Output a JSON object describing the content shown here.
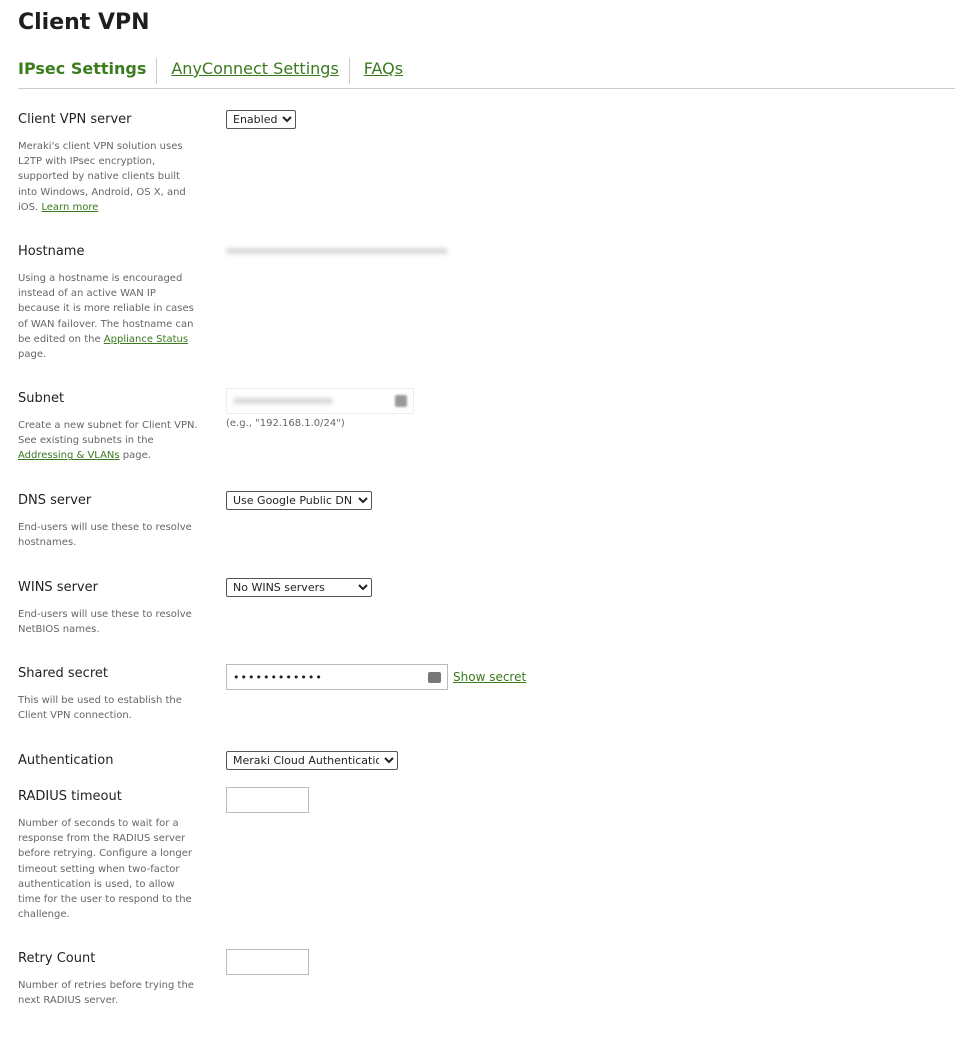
{
  "page": {
    "title": "Client VPN"
  },
  "tabs": [
    {
      "label": "IPsec Settings",
      "active": true
    },
    {
      "label": "AnyConnect Settings"
    },
    {
      "label": "FAQs"
    }
  ],
  "fields": {
    "server": {
      "label": "Client VPN server",
      "desc": "Meraki's client VPN solution uses L2TP with IPsec encryption, supported by native clients built into Windows, Android, OS X, and iOS. ",
      "link": "Learn more",
      "value": "Enabled"
    },
    "hostname": {
      "label": "Hostname",
      "desc1": "Using a hostname is encouraged instead of an active WAN IP because it is more reliable in cases of WAN failover. The hostname can be edited on the ",
      "link": "Appliance Status",
      "desc2": " page."
    },
    "subnet": {
      "label": "Subnet",
      "desc1": "Create a new subnet for Client VPN. See existing subnets in the ",
      "link": "Addressing & VLANs",
      "desc2": " page.",
      "hint": "(e.g., \"192.168.1.0/24\")"
    },
    "dns": {
      "label": "DNS server",
      "desc": "End-users will use these to resolve hostnames.",
      "value": "Use Google Public DNS"
    },
    "wins": {
      "label": "WINS server",
      "desc": "End-users will use these to resolve NetBIOS names.",
      "value": "No WINS servers"
    },
    "secret": {
      "label": "Shared secret",
      "desc": "This will be used to establish the Client VPN connection.",
      "value": "••••••••••••",
      "show": "Show secret"
    },
    "auth": {
      "label": "Authentication",
      "value": "Meraki Cloud Authentication"
    },
    "radius": {
      "label": "RADIUS timeout",
      "desc": "Number of seconds to wait for a response from the RADIUS server before retrying. Configure a longer timeout setting when two-factor authentication is used, to allow time for the user to respond to the challenge.",
      "value": ""
    },
    "retry": {
      "label": "Retry Count",
      "desc": "Number of retries before trying the next RADIUS server.",
      "value": ""
    }
  },
  "colors": {
    "accent": "#3b7d1d"
  }
}
